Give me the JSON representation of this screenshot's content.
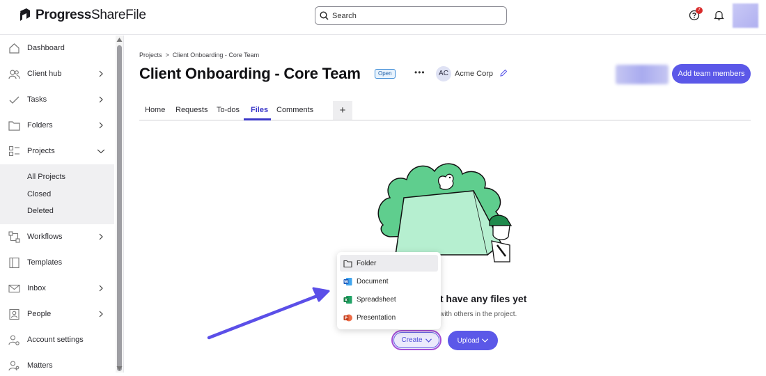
{
  "header": {
    "logo_brand": "Progress",
    "logo_product": "ShareFile",
    "search_placeholder": "Search",
    "help_badge": "7"
  },
  "sidebar": {
    "items": [
      {
        "label": "Dashboard",
        "icon": "home-icon"
      },
      {
        "label": "Client hub",
        "icon": "users-icon"
      },
      {
        "label": "Tasks",
        "icon": "check-icon"
      },
      {
        "label": "Folders",
        "icon": "folder-icon"
      },
      {
        "label": "Projects",
        "icon": "projects-icon"
      },
      {
        "label": "Workflows",
        "icon": "workflow-icon"
      },
      {
        "label": "Templates",
        "icon": "template-icon"
      },
      {
        "label": "Inbox",
        "icon": "mail-icon"
      },
      {
        "label": "People",
        "icon": "person-icon"
      },
      {
        "label": "Account settings",
        "icon": "settings-icon"
      },
      {
        "label": "Matters",
        "icon": "matters-icon"
      }
    ],
    "projects_sub": [
      "All Projects",
      "Closed",
      "Deleted"
    ]
  },
  "breadcrumb": {
    "root": "Projects",
    "separator": ">",
    "current": "Client Onboarding - Core Team"
  },
  "project": {
    "title": "Client Onboarding - Core Team",
    "status": "Open",
    "client_initials": "AC",
    "client_name": "Acme Corp",
    "add_members_label": "Add team members"
  },
  "tabs": [
    "Home",
    "Requests",
    "To-dos",
    "Files",
    "Comments"
  ],
  "active_tab": "Files",
  "empty_state": {
    "title": "n't have any files yet",
    "subtitle": "m with others in the project.",
    "create_label": "Create",
    "upload_label": "Upload"
  },
  "create_menu": {
    "items": [
      {
        "label": "Folder",
        "icon": "folder-outline-icon"
      },
      {
        "label": "Document",
        "icon": "word-icon"
      },
      {
        "label": "Spreadsheet",
        "icon": "excel-icon"
      },
      {
        "label": "Presentation",
        "icon": "powerpoint-icon"
      }
    ]
  },
  "colors": {
    "accent": "#5b58e8",
    "illustration_green": "#5fce8e",
    "illustration_light": "#b6efd0"
  }
}
